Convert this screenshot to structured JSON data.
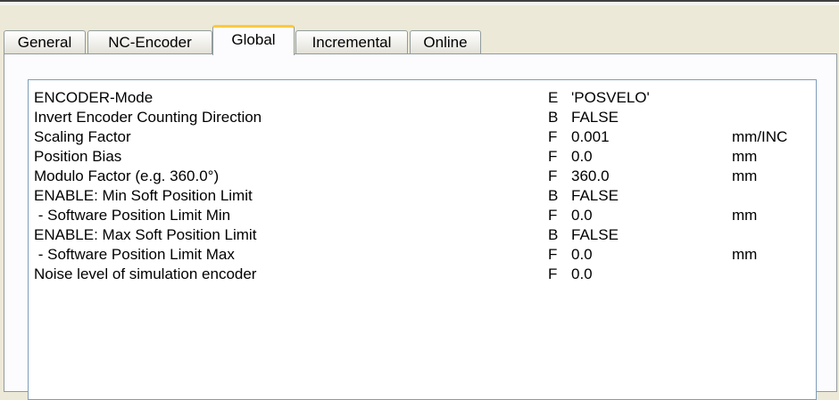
{
  "tabs": [
    {
      "label": "General",
      "active": false
    },
    {
      "label": "NC-Encoder",
      "active": false
    },
    {
      "label": "Global",
      "active": true
    },
    {
      "label": "Incremental",
      "active": false
    },
    {
      "label": "Online",
      "active": false
    }
  ],
  "parameters": [
    {
      "name": "ENCODER-Mode",
      "type": "E",
      "value": "'POSVELO'",
      "unit": ""
    },
    {
      "name": "Invert Encoder Counting Direction",
      "type": "B",
      "value": "FALSE",
      "unit": ""
    },
    {
      "name": "Scaling Factor",
      "type": "F",
      "value": "0.001",
      "unit": "mm/INC"
    },
    {
      "name": "Position Bias",
      "type": "F",
      "value": "0.0",
      "unit": "mm"
    },
    {
      "name": "Modulo Factor (e.g. 360.0°)",
      "type": "F",
      "value": "360.0",
      "unit": "mm"
    },
    {
      "name": "ENABLE: Min Soft Position Limit",
      "type": "B",
      "value": "FALSE",
      "unit": ""
    },
    {
      "name": " - Software Position Limit Min",
      "type": "F",
      "value": "0.0",
      "unit": "mm"
    },
    {
      "name": "ENABLE: Max Soft Position Limit",
      "type": "B",
      "value": "FALSE",
      "unit": ""
    },
    {
      "name": " - Software Position Limit Max",
      "type": "F",
      "value": "0.0",
      "unit": "mm"
    },
    {
      "name": "Noise level of simulation encoder",
      "type": "F",
      "value": "0.0",
      "unit": ""
    }
  ]
}
